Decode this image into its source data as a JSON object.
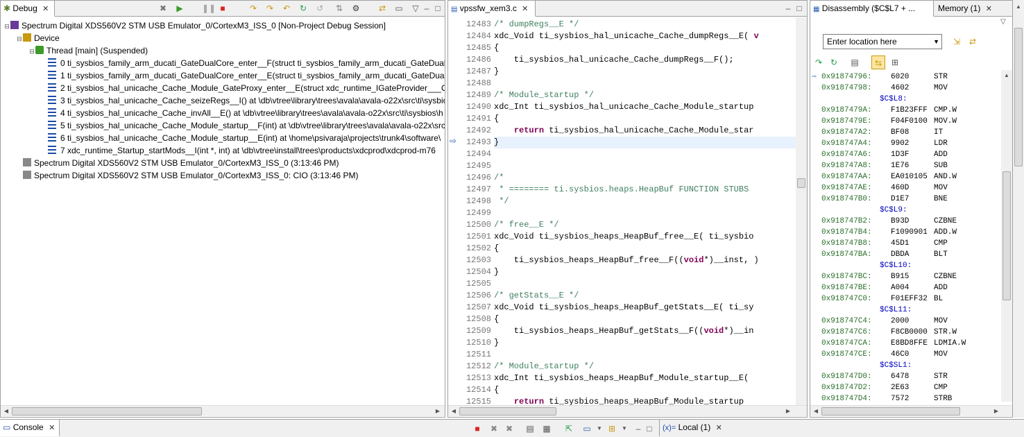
{
  "debug": {
    "tab_label": "Debug",
    "tree": [
      {
        "level": 0,
        "toggle": "−",
        "text": "Spectrum Digital XDS560V2 STM USB Emulator_0/CortexM3_ISS_0 [Non-Project Debug Session]",
        "type": "session"
      },
      {
        "level": 1,
        "toggle": "−",
        "text": "Device",
        "type": "device"
      },
      {
        "level": 2,
        "toggle": "−",
        "text": "Thread [main] (Suspended)",
        "type": "thread"
      },
      {
        "level": 3,
        "toggle": "",
        "text": "0 ti_sysbios_family_arm_ducati_GateDualCore_enter__F(struct ti_sysbios_family_arm_ducati_GateDualCo",
        "type": "frame"
      },
      {
        "level": 3,
        "toggle": "",
        "text": "1 ti_sysbios_family_arm_ducati_GateDualCore_enter__E(struct ti_sysbios_family_arm_ducati_GateDualCo",
        "type": "frame"
      },
      {
        "level": 3,
        "toggle": "",
        "text": "2 ti_sysbios_hal_unicache_Cache_Module_GateProxy_enter__E(struct xdc_runtime_IGateProvider___Obje",
        "type": "frame"
      },
      {
        "level": 3,
        "toggle": "",
        "text": "3 ti_sysbios_hal_unicache_Cache_seizeRegs__I() at \\db\\vtree\\library\\trees\\avala\\avala-o22x\\src\\ti\\sysbio",
        "type": "frame"
      },
      {
        "level": 3,
        "toggle": "",
        "text": "4 ti_sysbios_hal_unicache_Cache_invAll__E() at \\db\\vtree\\library\\trees\\avala\\avala-o22x\\src\\ti\\sysbios\\h",
        "type": "frame"
      },
      {
        "level": 3,
        "toggle": "",
        "text": "5 ti_sysbios_hal_unicache_Cache_Module_startup__F(int) at \\db\\vtree\\library\\trees\\avala\\avala-o22x\\src",
        "type": "frame"
      },
      {
        "level": 3,
        "toggle": "",
        "text": "6 ti_sysbios_hal_unicache_Cache_Module_startup__E(int) at \\home\\psivaraja\\projects\\trunk4\\software\\",
        "type": "frame"
      },
      {
        "level": 3,
        "toggle": "",
        "text": "7 xdc_runtime_Startup_startMods__I(int *, int) at \\db\\vtree\\install\\trees\\products\\xdcprod\\xdcprod-m76",
        "type": "frame"
      },
      {
        "level": 1,
        "toggle": "",
        "text": "Spectrum Digital XDS560V2 STM USB Emulator_0/CortexM3_ISS_0 (3:13:46 PM)",
        "type": "process"
      },
      {
        "level": 1,
        "toggle": "",
        "text": "Spectrum Digital XDS560V2 STM USB Emulator_0/CortexM3_ISS_0: CIO (3:13:46 PM)",
        "type": "process"
      }
    ]
  },
  "editor": {
    "tab_label": "vpssfw_xem3.c",
    "lines": [
      {
        "n": "12483",
        "html": "<span class='cm'>/* dumpRegs__E */</span>"
      },
      {
        "n": "12484",
        "html": "xdc_Void ti_sysbios_hal_unicache_Cache_dumpRegs__E( <span class='kw'>v</span>"
      },
      {
        "n": "12485",
        "html": "{"
      },
      {
        "n": "12486",
        "html": "    ti_sysbios_hal_unicache_Cache_dumpRegs__F();"
      },
      {
        "n": "12487",
        "html": "}"
      },
      {
        "n": "12488",
        "html": ""
      },
      {
        "n": "12489",
        "html": "<span class='cm'>/* Module_startup */</span>"
      },
      {
        "n": "12490",
        "html": "xdc_Int ti_sysbios_hal_unicache_Cache_Module_startup"
      },
      {
        "n": "12491",
        "html": "{"
      },
      {
        "n": "12492",
        "html": "    <span class='kw'>return</span> ti_sysbios_hal_unicache_Cache_Module_star"
      },
      {
        "n": "12493",
        "html": "}"
      },
      {
        "n": "12494",
        "html": ""
      },
      {
        "n": "12495",
        "html": ""
      },
      {
        "n": "12496",
        "html": "<span class='cm'>/*</span>"
      },
      {
        "n": "12497",
        "html": "<span class='cm'> * ======== ti.sysbios.heaps.HeapBuf FUNCTION STUBS</span>"
      },
      {
        "n": "12498",
        "html": "<span class='cm'> */</span>"
      },
      {
        "n": "12499",
        "html": ""
      },
      {
        "n": "12500",
        "html": "<span class='cm'>/* free__E */</span>"
      },
      {
        "n": "12501",
        "html": "xdc_Void ti_sysbios_heaps_HeapBuf_free__E( ti_sysbio"
      },
      {
        "n": "12502",
        "html": "{"
      },
      {
        "n": "12503",
        "html": "    ti_sysbios_heaps_HeapBuf_free__F((<span class='kw'>void</span>*)__inst, )"
      },
      {
        "n": "12504",
        "html": "}"
      },
      {
        "n": "12505",
        "html": ""
      },
      {
        "n": "12506",
        "html": "<span class='cm'>/* getStats__E */</span>"
      },
      {
        "n": "12507",
        "html": "xdc_Void ti_sysbios_heaps_HeapBuf_getStats__E( ti_sy"
      },
      {
        "n": "12508",
        "html": "{"
      },
      {
        "n": "12509",
        "html": "    ti_sysbios_heaps_HeapBuf_getStats__F((<span class='kw'>void</span>*)__in"
      },
      {
        "n": "12510",
        "html": "}"
      },
      {
        "n": "12511",
        "html": ""
      },
      {
        "n": "12512",
        "html": "<span class='cm'>/* Module_startup */</span>"
      },
      {
        "n": "12513",
        "html": "xdc_Int ti_sysbios_heaps_HeapBuf_Module_startup__E( "
      },
      {
        "n": "12514",
        "html": "{"
      },
      {
        "n": "12515",
        "html": "    <span class='kw'>return</span> ti_sysbios_heaps_HeapBuf_Module_startup"
      }
    ],
    "current_line": "12493"
  },
  "disassembly": {
    "tab_label": "Disassembly ($C$L7 + ...",
    "memory_tab_label": "Memory (1)",
    "location_placeholder": "Enter location here",
    "rows": [
      {
        "kind": "ins",
        "addr": "0x91874796:",
        "op": "6020",
        "mn": "STR",
        "current": true
      },
      {
        "kind": "ins",
        "addr": "0x91874798:",
        "op": "4602",
        "mn": "MOV"
      },
      {
        "kind": "label",
        "text": "$C$L8:"
      },
      {
        "kind": "ins",
        "addr": "0x9187479A:",
        "op": "F1B23FFF",
        "mn": "CMP.W"
      },
      {
        "kind": "ins",
        "addr": "0x9187479E:",
        "op": "F04F0100",
        "mn": "MOV.W"
      },
      {
        "kind": "ins",
        "addr": "0x918747A2:",
        "op": "BF08",
        "mn": "IT"
      },
      {
        "kind": "ins",
        "addr": "0x918747A4:",
        "op": "9902",
        "mn": "LDR"
      },
      {
        "kind": "ins",
        "addr": "0x918747A6:",
        "op": "1D3F",
        "mn": "ADD"
      },
      {
        "kind": "ins",
        "addr": "0x918747A8:",
        "op": "1E76",
        "mn": "SUB"
      },
      {
        "kind": "ins",
        "addr": "0x918747AA:",
        "op": "EA010105",
        "mn": "AND.W"
      },
      {
        "kind": "ins",
        "addr": "0x918747AE:",
        "op": "460D",
        "mn": "MOV"
      },
      {
        "kind": "ins",
        "addr": "0x918747B0:",
        "op": "D1E7",
        "mn": "BNE"
      },
      {
        "kind": "label",
        "text": "$C$L9:"
      },
      {
        "kind": "ins",
        "addr": "0x918747B2:",
        "op": "B93D",
        "mn": "CZBNE"
      },
      {
        "kind": "ins",
        "addr": "0x918747B4:",
        "op": "F1090901",
        "mn": "ADD.W"
      },
      {
        "kind": "ins",
        "addr": "0x918747B8:",
        "op": "45D1",
        "mn": "CMP"
      },
      {
        "kind": "ins",
        "addr": "0x918747BA:",
        "op": "DBDA",
        "mn": "BLT"
      },
      {
        "kind": "label",
        "text": "$C$L10:"
      },
      {
        "kind": "ins",
        "addr": "0x918747BC:",
        "op": "B915",
        "mn": "CZBNE"
      },
      {
        "kind": "ins",
        "addr": "0x918747BE:",
        "op": "A004",
        "mn": "ADD"
      },
      {
        "kind": "ins",
        "addr": "0x918747C0:",
        "op": "F01EFF32",
        "mn": "BL"
      },
      {
        "kind": "label",
        "text": "$C$L11:"
      },
      {
        "kind": "ins",
        "addr": "0x918747C4:",
        "op": "2000",
        "mn": "MOV"
      },
      {
        "kind": "ins",
        "addr": "0x918747C6:",
        "op": "F8CB0000",
        "mn": "STR.W"
      },
      {
        "kind": "ins",
        "addr": "0x918747CA:",
        "op": "E8BD8FFE",
        "mn": "LDMIA.W"
      },
      {
        "kind": "ins",
        "addr": "0x918747CE:",
        "op": "46C0",
        "mn": "MOV"
      },
      {
        "kind": "label",
        "text": "$C$SL1:"
      },
      {
        "kind": "ins",
        "addr": "0x918747D0:",
        "op": "6478",
        "mn": "STR"
      },
      {
        "kind": "ins",
        "addr": "0x918747D2:",
        "op": "2E63",
        "mn": "CMP"
      },
      {
        "kind": "ins",
        "addr": "0x918747D4:",
        "op": "7572",
        "mn": "STRB"
      }
    ]
  },
  "bottom": {
    "console_tab_label": "Console",
    "local_tab_label": "Local (1)",
    "local_prefix": "(x)="
  },
  "colors": {
    "tab_bg": "#f0f0f0",
    "current_line_bg": "#e8f2fe",
    "address": "#2a6e2a",
    "label": "#0000c0",
    "comment": "#3f7f5f",
    "keyword": "#7f0055"
  },
  "icons": [
    "debug-icon",
    "resume-icon",
    "suspend-icon",
    "terminate-icon",
    "step-into-icon",
    "step-over-icon",
    "step-return-icon",
    "gear-icon",
    "console-icon",
    "instruction-pointer-icon"
  ]
}
